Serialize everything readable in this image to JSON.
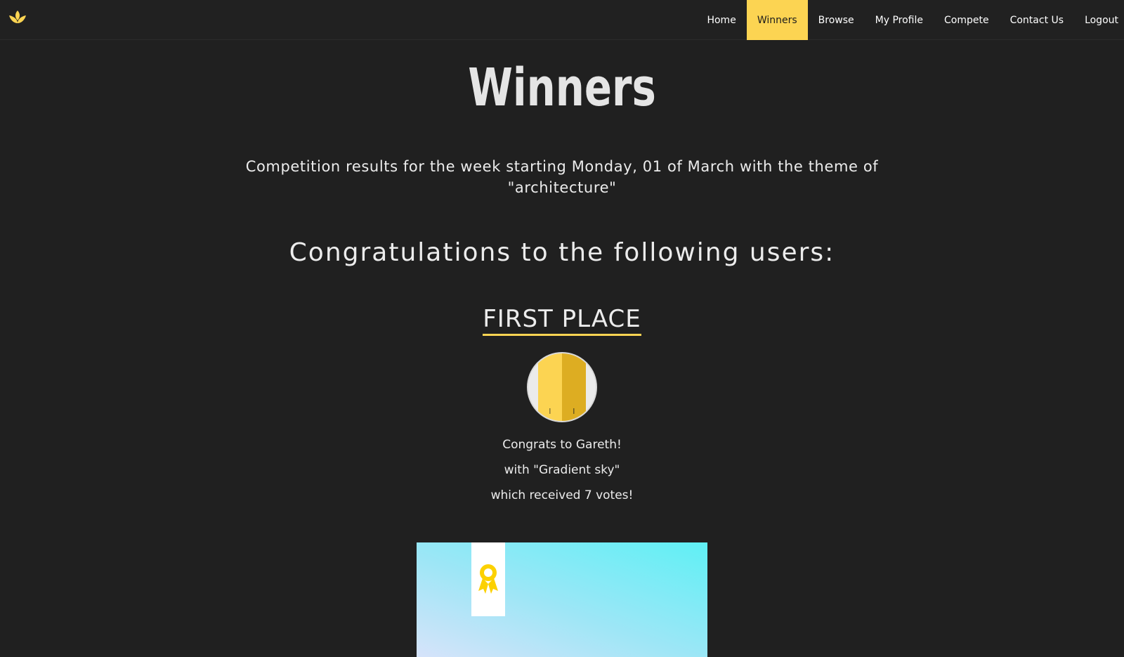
{
  "nav": {
    "items": [
      {
        "label": "Home"
      },
      {
        "label": "Winners",
        "active": true
      },
      {
        "label": "Browse"
      },
      {
        "label": "My Profile"
      },
      {
        "label": "Compete"
      },
      {
        "label": "Contact Us"
      },
      {
        "label": "Logout"
      }
    ]
  },
  "page": {
    "title": "Winners",
    "intro": "Competition results for the week starting Monday, 01 of March with the theme of \"architecture\"",
    "congrats_heading": "Congratulations to the following users:"
  },
  "first_place": {
    "heading": "FIRST PLACE",
    "line1": "Congrats to Gareth!",
    "line2": "with \"Gradient sky\"",
    "line3": "which received 7 votes!"
  },
  "colors": {
    "accent": "#fcd452",
    "background": "#202020",
    "nav_background": "#212121"
  },
  "icons": {
    "logo": "lotus-icon",
    "award": "award-ribbon-icon"
  }
}
